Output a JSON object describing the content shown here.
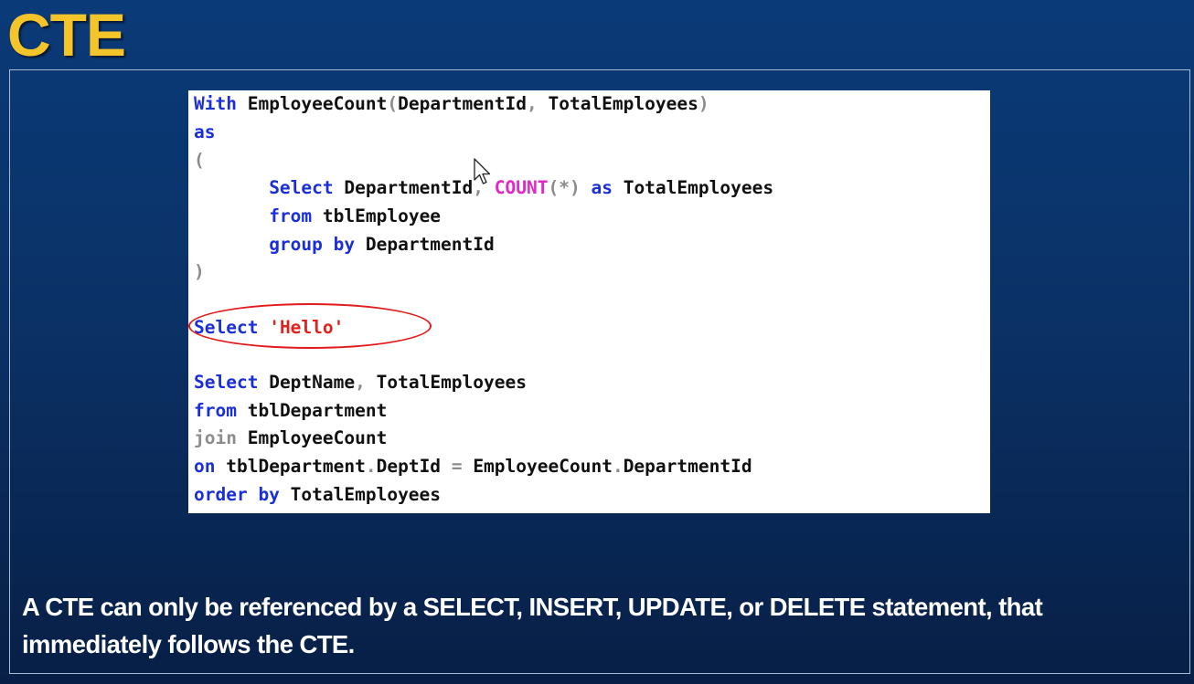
{
  "slide": {
    "title": "CTE",
    "note": "A CTE can only be referenced by a SELECT, INSERT, UPDATE, or DELETE statement, that immediately follows the CTE."
  },
  "code": {
    "l1": {
      "kw": "With",
      "name": "EmployeeCount",
      "open": "(",
      "col1": "DepartmentId",
      "comma": ",",
      "col2": "TotalEmployees",
      "close": ")"
    },
    "l2": {
      "kw": "as"
    },
    "l3": {
      "paren": "("
    },
    "l4": {
      "kw": "Select",
      "col": "DepartmentId",
      "comma": ",",
      "fn": "COUNT",
      "arg": "(*)",
      "kw2": "as",
      "alias": "TotalEmployees"
    },
    "l5": {
      "kw": "from",
      "table": "tblEmployee"
    },
    "l6": {
      "kw": "group by",
      "col": "DepartmentId"
    },
    "l7": {
      "paren": ")"
    },
    "l8": {
      "kw": "Select",
      "str": "'Hello'"
    },
    "l9": {
      "kw": "Select",
      "col": "DeptName",
      "comma": ",",
      "col2": "TotalEmployees"
    },
    "l10": {
      "kw": "from",
      "table": "tblDepartment"
    },
    "l11": {
      "kw": "join",
      "table": "EmployeeCount"
    },
    "l12": {
      "kw": "on",
      "t1": "tblDepartment",
      "dot1": ".",
      "c1": "DeptId",
      "eq": "=",
      "t2": "EmployeeCount",
      "dot2": ".",
      "c2": "DepartmentId"
    },
    "l13": {
      "kw": "order by",
      "col": "TotalEmployees"
    }
  },
  "colors": {
    "keyword": "#1a2fd8",
    "function": "#e028c8",
    "string": "#e0211e",
    "operator": "#8c8c8c",
    "title": "#f3c52a",
    "highlight": "#e11b1b"
  },
  "icons": {
    "pointer": "mouse-cursor-arrow-icon"
  }
}
